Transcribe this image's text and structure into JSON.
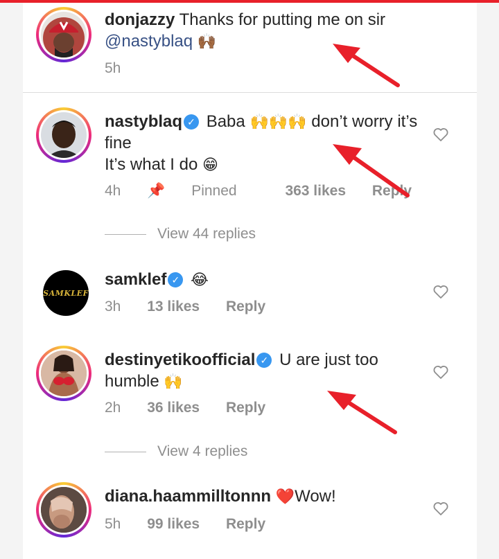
{
  "comments": [
    {
      "username": "donjazzy",
      "text": "Thanks for putting me on sir",
      "mention": "@nastyblaq",
      "emoji": "🙌🏾",
      "time": "5h"
    },
    {
      "username": "nastyblaq",
      "text_a": "Baba",
      "emoji_a": "🙌🙌🙌",
      "text_b": "don’t worry it’s fine",
      "text_c": "It’s what I do",
      "emoji_c": "😁",
      "time": "4h",
      "pinned": "Pinned",
      "likes": "363 likes",
      "reply": "Reply",
      "view_replies": "View 44 replies"
    },
    {
      "username": "samklef",
      "emoji": "😂",
      "avatar_text": "SAMKLEF",
      "time": "3h",
      "likes": "13 likes",
      "reply": "Reply"
    },
    {
      "username": "destinyetikoofficial",
      "text": "U are just too humble",
      "emoji": "🙌",
      "time": "2h",
      "likes": "36 likes",
      "reply": "Reply",
      "view_replies": "View 4 replies"
    },
    {
      "username": "diana.haammilltonnn",
      "emoji": "❤️",
      "text": "Wow!",
      "time": "5h",
      "likes": "99 likes",
      "reply": "Reply"
    }
  ],
  "colors": {
    "verified": "#3897f0",
    "mention": "#385185",
    "arrow": "#e8202a"
  }
}
